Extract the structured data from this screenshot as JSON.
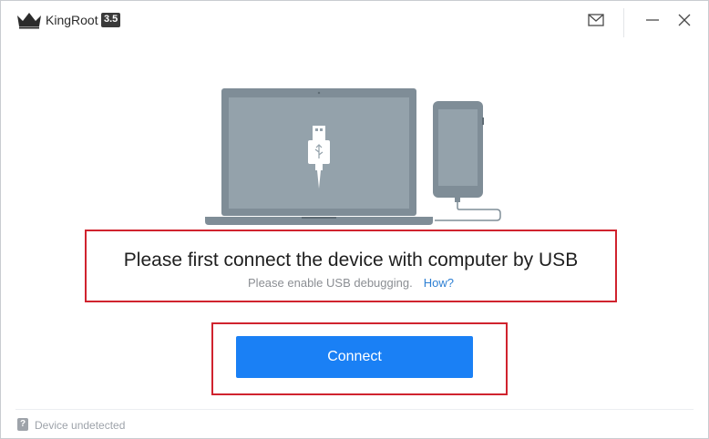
{
  "titlebar": {
    "app_name": "KingRoot",
    "version": "3.5",
    "icons": {
      "logo": "crown-logo-icon",
      "mail": "mail-icon",
      "minimize": "minimize-icon",
      "close": "close-icon"
    }
  },
  "illustration": {
    "icons": [
      "laptop-icon",
      "usb-icon",
      "phone-icon",
      "cable-icon"
    ]
  },
  "message": {
    "title": "Please first connect the device with computer by USB",
    "subtitle": "Please enable USB debugging.",
    "help_link": "How?"
  },
  "connect": {
    "button_label": "Connect"
  },
  "status": {
    "icon_glyph": "?",
    "text": "Device undetected"
  },
  "colors": {
    "accent": "#1a80f5",
    "highlight_border": "#d0232e",
    "link": "#2d7fd3",
    "device_gray": "#7f8d97",
    "device_screen": "#94a2ab"
  }
}
